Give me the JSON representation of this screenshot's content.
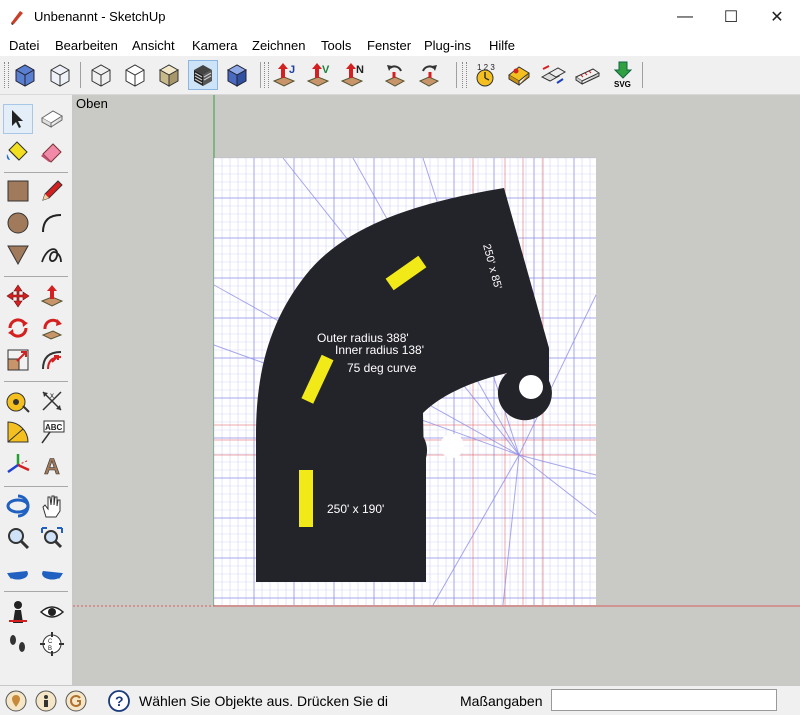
{
  "window": {
    "title": "Unbenannt - SketchUp",
    "minimize": "—",
    "maximize": "☐",
    "close": "✕"
  },
  "menu": [
    "Datei",
    "Bearbeiten",
    "Ansicht",
    "Kamera",
    "Zeichnen",
    "Tools",
    "Fenster",
    "Plug-ins",
    "Hilfe"
  ],
  "toolbar": {
    "icons": [
      "iso-view-icon",
      "xray-icon",
      "wireframe-icon",
      "hidden-line-icon",
      "shaded-icon",
      "shaded-textures-icon",
      "monochrome-icon",
      "extrude-j-icon",
      "extrude-v-icon",
      "extrude-n-icon",
      "rotate-left-icon",
      "rotate-right-icon",
      "numbering-icon",
      "dimension-icon",
      "mirror-icon",
      "ruler-icon"
    ],
    "svg_label": "SVG"
  },
  "left_tools": [
    "select",
    "component",
    "paint-bucket",
    "eraser",
    "rectangle",
    "pencil",
    "circle",
    "arc",
    "polygon",
    "freehand",
    "move",
    "push-pull",
    "rotate",
    "follow-me",
    "scale",
    "offset",
    "tape-measure",
    "dimension",
    "protractor",
    "text",
    "axes",
    "3d-text",
    "orbit",
    "pan",
    "zoom",
    "zoom-extents",
    "previous-view",
    "next-view",
    "position-camera",
    "look-around",
    "walk",
    "section-plane"
  ],
  "viewport": {
    "view_name": "Oben",
    "labels": {
      "dims_top": "250' x 85'",
      "outer_radius": "Outer radius 388'",
      "inner_radius": "Inner radius 138'",
      "curve": "75 deg curve",
      "dims_bottom": "250' x 190'"
    },
    "colors": {
      "track": "#23232a",
      "stripe": "#f2ea18",
      "grid": "#8a8ae6",
      "guide_red": "#e05050",
      "background": "#c9c9c6"
    }
  },
  "status": {
    "message": "Wählen Sie Objekte aus. Drücken Sie di",
    "measure_label": "Maßangaben",
    "measure_value": ""
  }
}
